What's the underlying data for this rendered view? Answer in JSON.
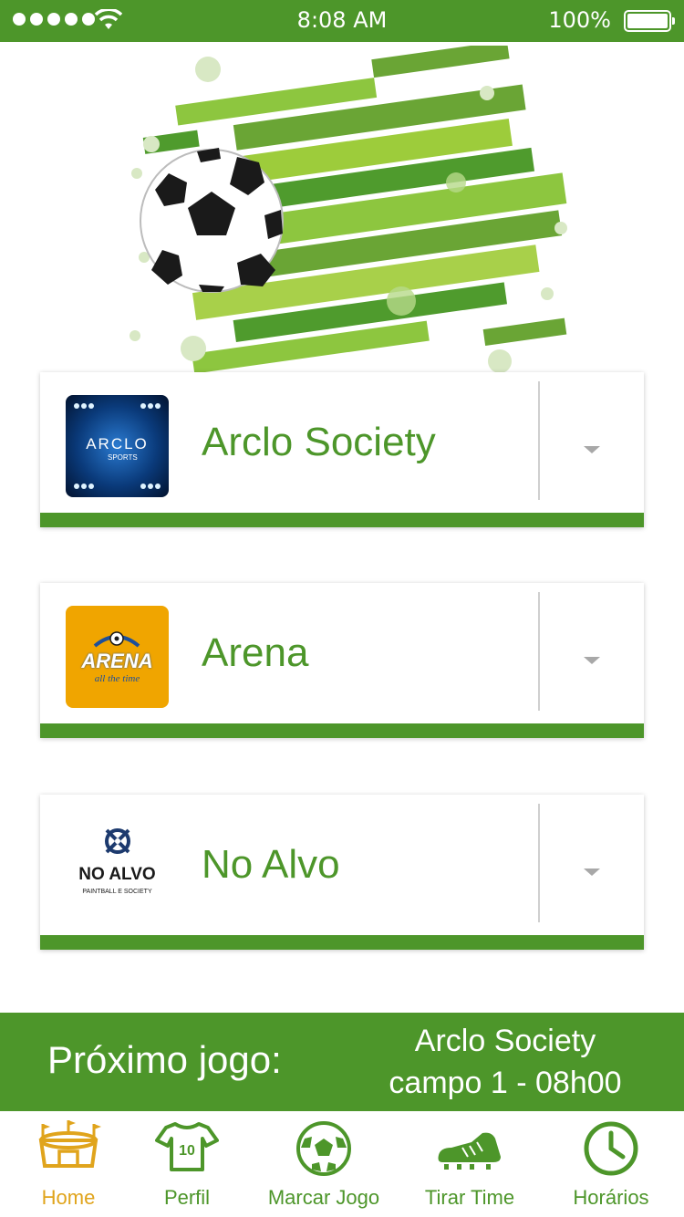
{
  "status_bar": {
    "time": "8:08 AM",
    "battery_percent": "100%"
  },
  "venues": [
    {
      "name": "Arclo Society",
      "logo_text": "ARCLO",
      "logo_subtext": "SPORTS"
    },
    {
      "name": "Arena",
      "logo_text": "ARENA",
      "logo_subtext": "all the time"
    },
    {
      "name": "No Alvo",
      "logo_text": "NO ALVO",
      "logo_subtext": "PAINTBALL E SOCIETY"
    }
  ],
  "next_game": {
    "label": "Próximo jogo:",
    "venue": "Arclo Society",
    "detail": "campo 1 - 08h00"
  },
  "tabs": [
    {
      "label": "Home",
      "icon": "stadium-icon",
      "active": true
    },
    {
      "label": "Perfil",
      "icon": "jersey-icon"
    },
    {
      "label": "Marcar Jogo",
      "icon": "soccer-ball-icon"
    },
    {
      "label": "Tirar Time",
      "icon": "cleat-icon"
    },
    {
      "label": "Horários",
      "icon": "clock-icon"
    }
  ],
  "colors": {
    "brand_green": "#4d962a",
    "active_tab": "#e0a41c",
    "arena_orange": "#f0a500",
    "arclo_blue": "#0a3a7a"
  }
}
